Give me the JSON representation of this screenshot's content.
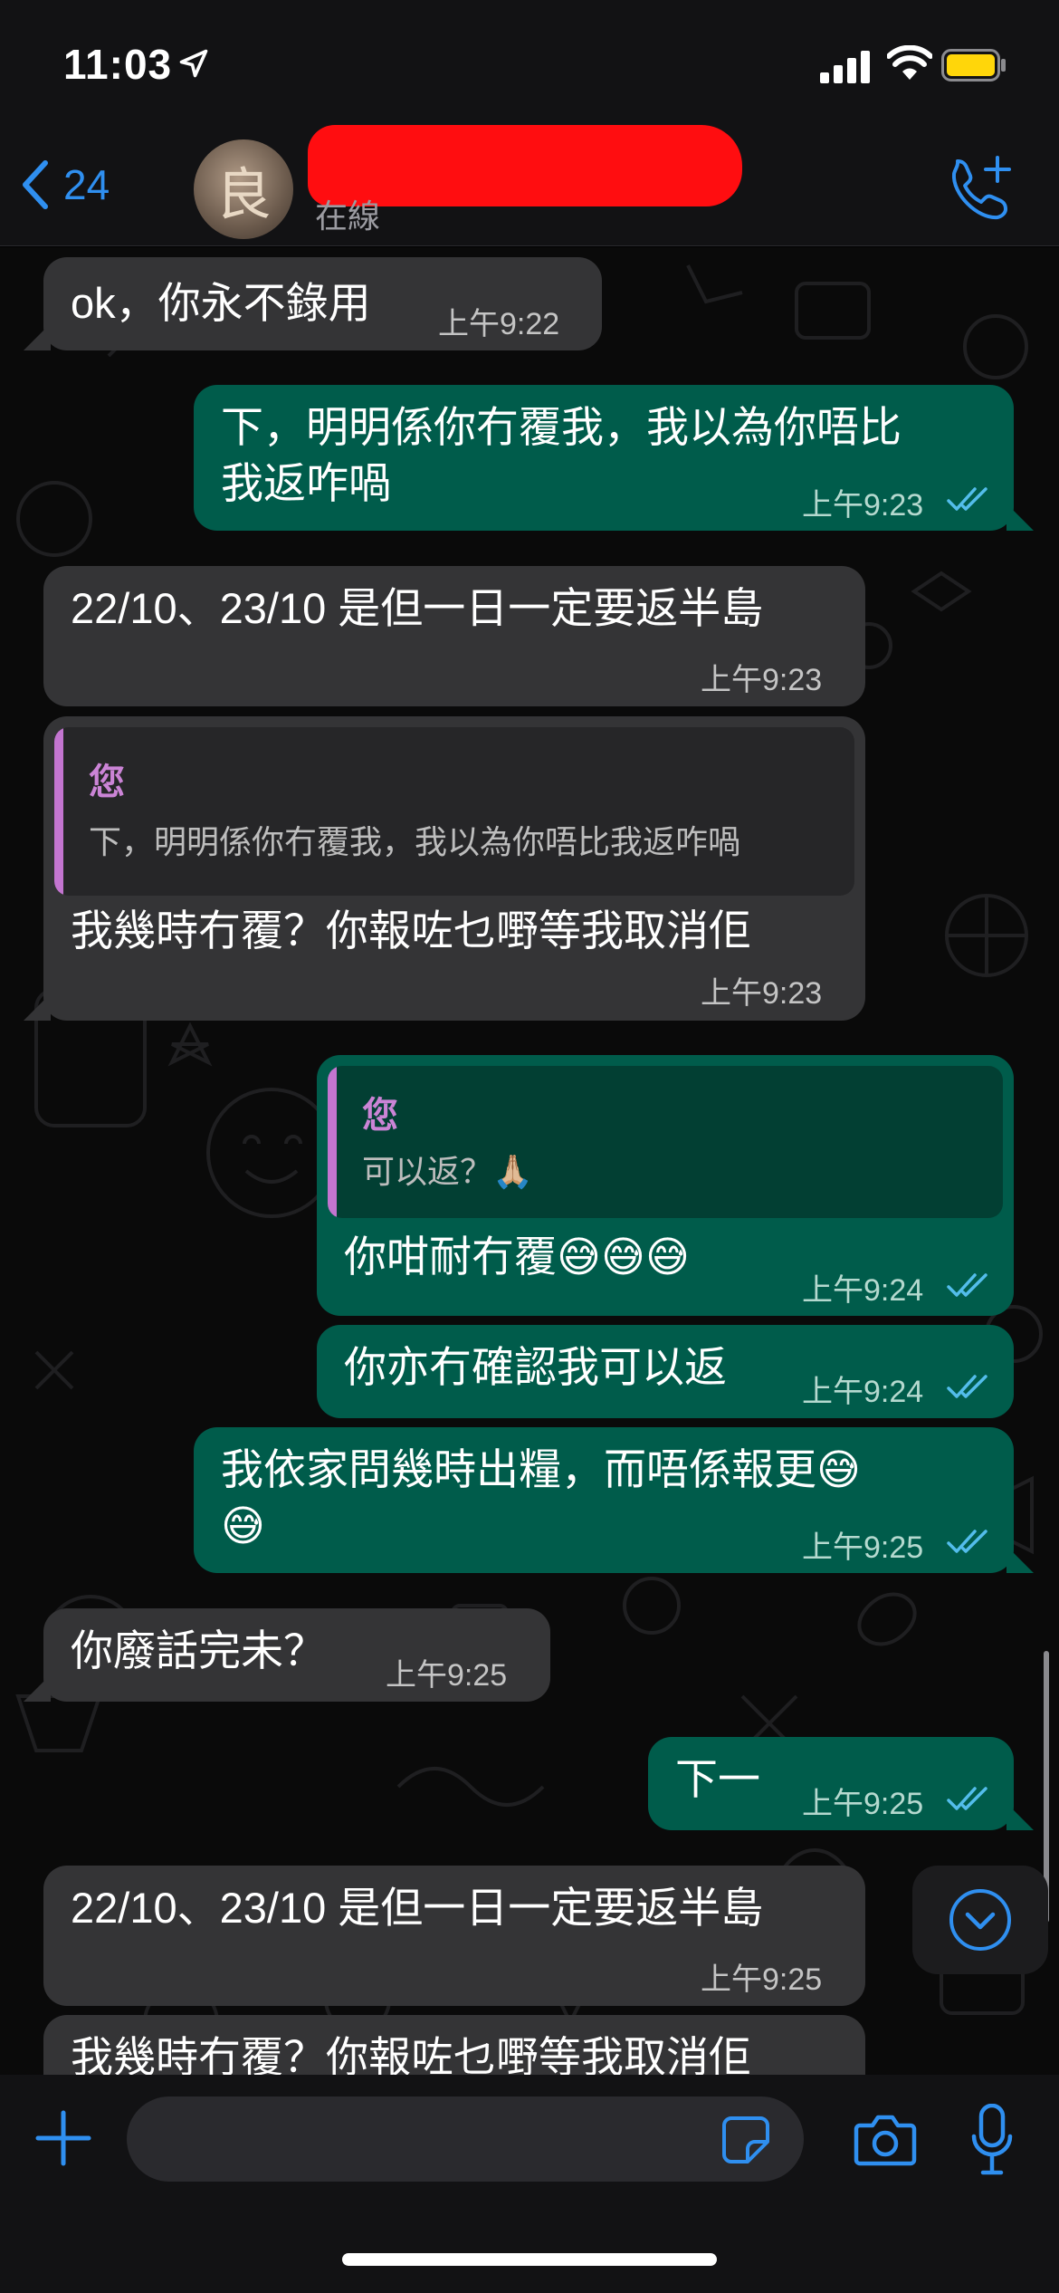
{
  "status_bar": {
    "time": "11:03"
  },
  "header": {
    "back_count": "24",
    "avatar_glyph": "良",
    "contact_status": "在線"
  },
  "you_label": "您",
  "messages": [
    {
      "text": "ok，你永不錄用",
      "time": "上午9:22"
    },
    {
      "text": "下，明明係你冇覆我，我以為你唔比\n我返咋喎",
      "time": "上午9:23"
    },
    {
      "text": "22/10、23/10 是但一日一定要返半島",
      "time": "上午9:23"
    },
    {
      "quote": "下，明明係你冇覆我，我以為你唔比我返咋喎",
      "text": "我幾時冇覆？你報咗乜嘢等我取消佢",
      "time": "上午9:23"
    },
    {
      "quote": "可以返？🙏🏼",
      "text": "你咁耐冇覆😅😅😅",
      "time": "上午9:24"
    },
    {
      "text": "你亦冇確認我可以返",
      "time": "上午9:24"
    },
    {
      "text": "我依家問幾時出糧，而唔係報更😅\n😅",
      "time": "上午9:25"
    },
    {
      "text": "你廢話完未？",
      "time": "上午9:25"
    },
    {
      "text": "下一",
      "time": "上午9:25"
    },
    {
      "text": "22/10、23/10 是但一日一定要返半島",
      "time": "上午9:25"
    },
    {
      "text": "我幾時冇覆？你報咗乜嘢等我取消佢"
    }
  ],
  "colors": {
    "accent": "#2f8ff0",
    "incoming": "#343436",
    "outgoing": "#005c4b",
    "quote_name": "#cb84d6"
  },
  "icons": [
    "location-arrow-icon",
    "signal-icon",
    "wifi-icon",
    "battery-icon",
    "back-chevron-icon",
    "call-add-icon",
    "chevron-down-icon",
    "plus-icon",
    "sticker-icon",
    "camera-icon",
    "mic-icon",
    "double-check-icon"
  ]
}
